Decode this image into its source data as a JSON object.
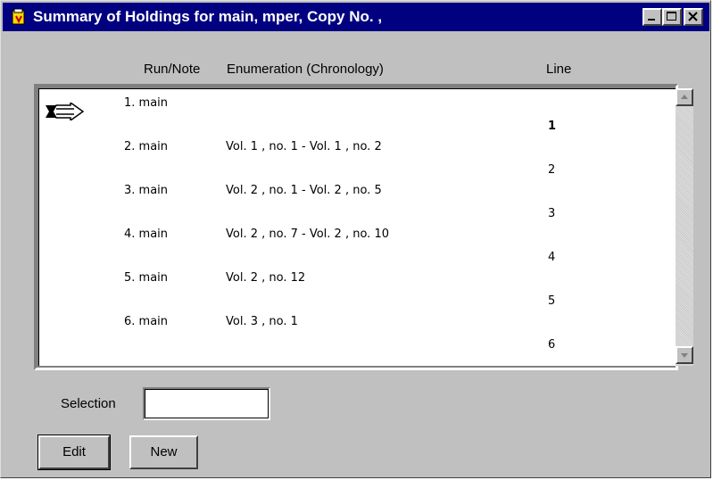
{
  "window": {
    "title": "Summary of Holdings for main, mper, Copy No. ,",
    "app_icon": "app-icon",
    "controls": {
      "minimize_icon": "minimize-icon",
      "maximize_icon": "maximize-icon",
      "close_icon": "close-icon"
    },
    "title_bar_color": "#000080",
    "face_color": "#c0c0c0"
  },
  "columns": {
    "run_note": "Run/Note",
    "enumeration": "Enumeration (Chronology)",
    "line": "Line"
  },
  "rows": [
    {
      "run": "1. main",
      "enumeration": "",
      "line": "1",
      "current": true
    },
    {
      "run": "2. main",
      "enumeration": "Vol. 1 , no. 1 - Vol. 1 , no. 2",
      "line": "2",
      "current": false
    },
    {
      "run": "3. main",
      "enumeration": "Vol. 2 , no. 1 - Vol. 2 , no. 5",
      "line": "3",
      "current": false
    },
    {
      "run": "4. main",
      "enumeration": "Vol. 2 , no. 7 - Vol. 2 , no. 10",
      "line": "4",
      "current": false
    },
    {
      "run": "5. main",
      "enumeration": "Vol. 2 , no. 12",
      "line": "5",
      "current": false
    },
    {
      "run": "6. main",
      "enumeration": "Vol. 3 , no. 1",
      "line": "6",
      "current": false
    }
  ],
  "current_row_icon": "pointer-arrow-icon",
  "scrollbar": {
    "up_icon": "scroll-up-icon",
    "down_icon": "scroll-down-icon"
  },
  "selection": {
    "label": "Selection",
    "value": ""
  },
  "buttons": {
    "edit": "Edit",
    "new": "New"
  }
}
